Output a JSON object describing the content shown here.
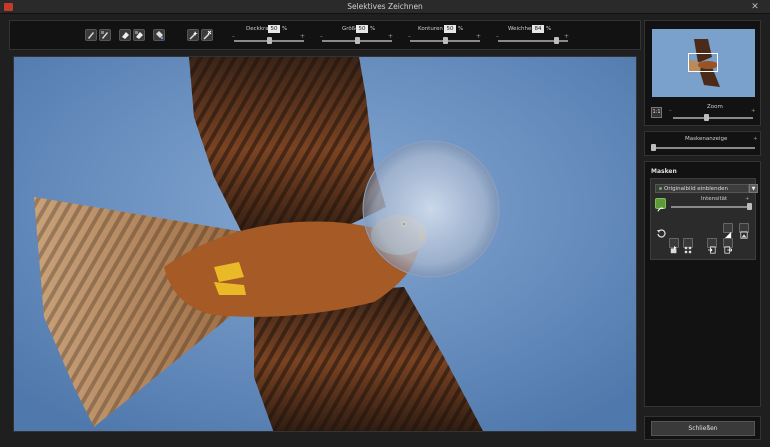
{
  "window": {
    "title": "Selektives Zeichnen",
    "close_glyph": "✕"
  },
  "toolbar": {
    "tools": [
      {
        "name": "brush-icon"
      },
      {
        "name": "brush-soft-icon"
      },
      {
        "name": "eraser-icon"
      },
      {
        "name": "eraser-soft-icon"
      },
      {
        "name": "fill-bucket-icon"
      },
      {
        "name": "wand-icon"
      },
      {
        "name": "wand-erase-icon"
      }
    ],
    "sliders": {
      "deckkraft": {
        "label": "Deckkraft",
        "value": "50",
        "unit": "%",
        "fraction": 0.5
      },
      "groesse": {
        "label": "Größe",
        "value": "50",
        "unit": "%",
        "fraction": 0.5
      },
      "konturen": {
        "label": "Konturen",
        "value": "50",
        "unit": "%",
        "fraction": 0.5
      },
      "weichheit": {
        "label": "Weichheit",
        "value": "84",
        "unit": "%",
        "fraction": 0.84
      }
    }
  },
  "navigator": {
    "fit_label": "1:1",
    "zoom_label": "Zoom",
    "zoom_fraction": 0.42
  },
  "mask_display": {
    "label": "Maskenanzeige",
    "fraction": 0.0
  },
  "masks": {
    "title": "Masken",
    "dropdown_value": "Originalbild einblenden",
    "intensity_label": "Intensität",
    "intensity_fraction": 0.98
  },
  "footer": {
    "close_label": "Schließen"
  },
  "colors": {
    "sky": "#6b93c2",
    "accent_green": "#5d9a3c",
    "panel_bg": "#121212"
  }
}
